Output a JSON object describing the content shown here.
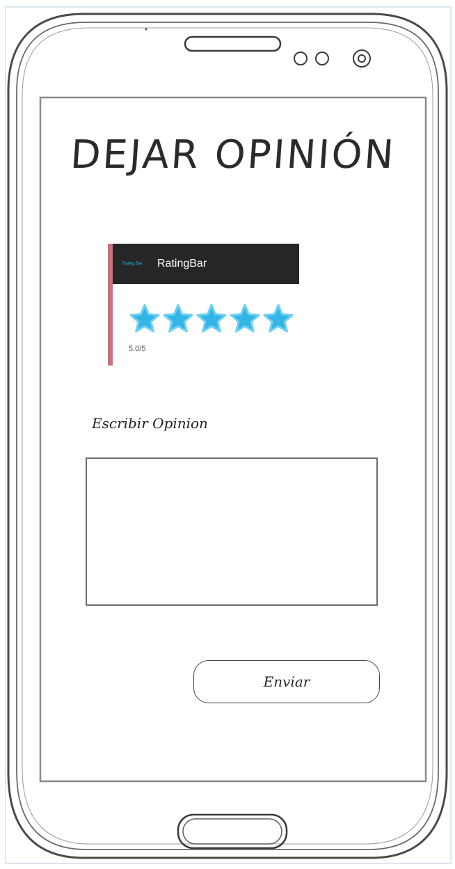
{
  "screen": {
    "title": "DEJAR OPINIÓN"
  },
  "rating_widget": {
    "small_label": "Rating Bar",
    "title": "RatingBar",
    "rating": 5,
    "max_rating": 5,
    "value_text": "5.0/5",
    "accent_color": "#c4727c",
    "header_color": "#262626",
    "star_color": "#33b5e5"
  },
  "opinion": {
    "label": "Escribir Opinion",
    "value": ""
  },
  "actions": {
    "send_label": "Enviar"
  }
}
